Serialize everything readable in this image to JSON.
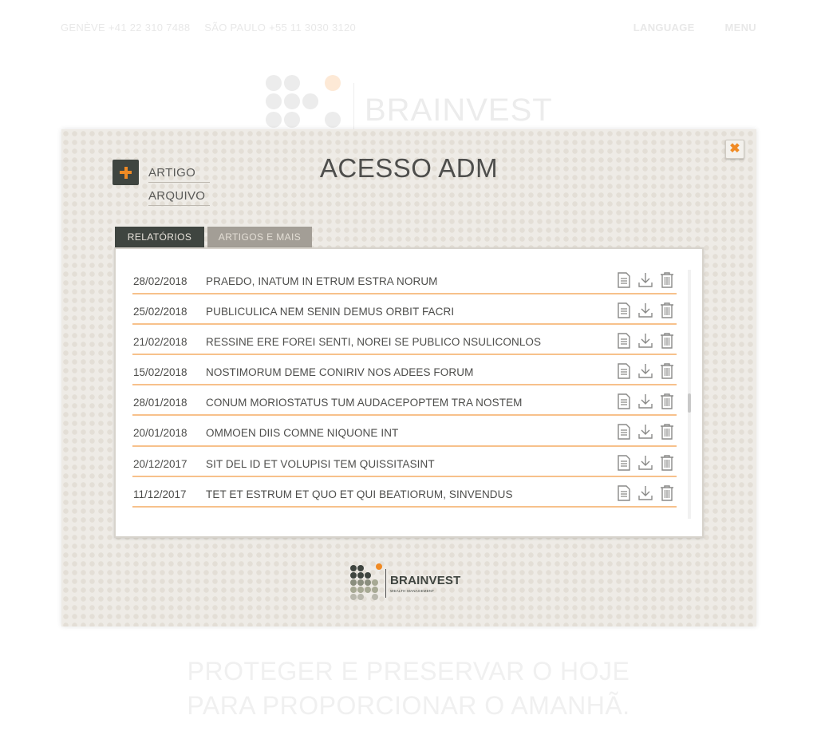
{
  "background": {
    "contacts": [
      "GENÈVE +41 22 310 7488",
      "SÃO PAULO +55 11 3030 3120"
    ],
    "nav": [
      "LANGUAGE",
      "MENU"
    ],
    "logo_text": "BRAINVEST",
    "slogan_line1": "PROTEGER E PRESERVAR O HOJE",
    "slogan_line2": "PARA PROPORCIONAR O AMANHÃ."
  },
  "modal": {
    "title": "ACESSO ADM",
    "close_glyph": "✖",
    "add_links": {
      "artigo": "ARTIGO",
      "arquivo": "ARQUIVO"
    },
    "tabs": [
      {
        "label": "RELATÓRIOS",
        "active": true
      },
      {
        "label": "ARTIGOS E MAIS",
        "active": false
      }
    ],
    "rows": [
      {
        "date": "28/02/2018",
        "title": "PRAEDO, INATUM IN ETRUM ESTRA NORUM"
      },
      {
        "date": "25/02/2018",
        "title": "PUBLICULICA NEM SENIN DEMUS ORBIT FACRI"
      },
      {
        "date": "21/02/2018",
        "title": "RESSINE ERE FOREI SENTI, NOREI SE PUBLICO NSULICONLOS"
      },
      {
        "date": "15/02/2018",
        "title": "NOSTIMORUM DEME CONIRIV NOS ADEES FORUM"
      },
      {
        "date": "28/01/2018",
        "title": "CONUM MORIOSTATUS TUM AUDACEPOPTEM TRA NOSTEM"
      },
      {
        "date": "20/01/2018",
        "title": "OMMOEN DIIS COMNE NIQUONE INT"
      },
      {
        "date": "20/12/2017",
        "title": "SIT DEL ID ET VOLUPISI TEM QUISSITASINT"
      },
      {
        "date": "11/12/2017",
        "title": "TET ET ESTRUM ET QUO ET QUI BEATIORUM, SINVENDUS"
      }
    ],
    "row_icons": [
      "document-icon",
      "download-icon",
      "trash-icon"
    ],
    "footer_logo": {
      "name": "BRAINVEST",
      "subtitle": "WEALTH MANAGEMENT"
    }
  },
  "colors": {
    "accent_orange": "#f08a24",
    "dark_green": "#3f4540",
    "row_divider": "#f7c18b",
    "inactive_tab": "#a39e96"
  }
}
